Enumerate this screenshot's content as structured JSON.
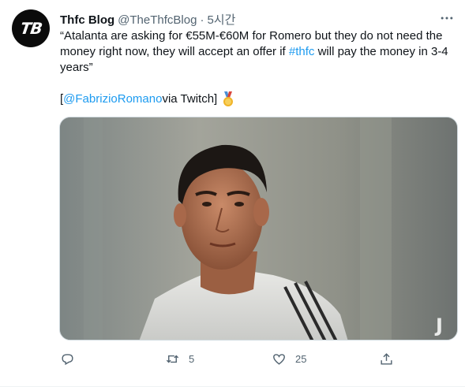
{
  "tweet": {
    "avatar_text": "TB",
    "display_name": "Thfc Blog",
    "handle": "@TheThfcBlog",
    "separator": "·",
    "time": "5시간",
    "text_before": "“Atalanta are asking for €55M-€60M for Romero but they do not need the money right now, they will accept an offer if ",
    "hashtag": "#thfc",
    "text_after": " will pay the money in 3-4 years”",
    "bracket_open": "[",
    "mention": "@FabrizioRomano",
    "via_text": " via Twitch]",
    "media_watermark": "J"
  },
  "actions": {
    "reply_count": "",
    "retweet_count": "5",
    "like_count": "25"
  },
  "icons": {
    "more": "more-icon",
    "reply": "reply-icon",
    "retweet": "retweet-icon",
    "like": "heart-icon",
    "share": "share-icon",
    "medal": "medal-icon"
  },
  "colors": {
    "link": "#1d9bf0",
    "secondary_text": "#536471",
    "avatar_bg": "#0b0b0b"
  }
}
